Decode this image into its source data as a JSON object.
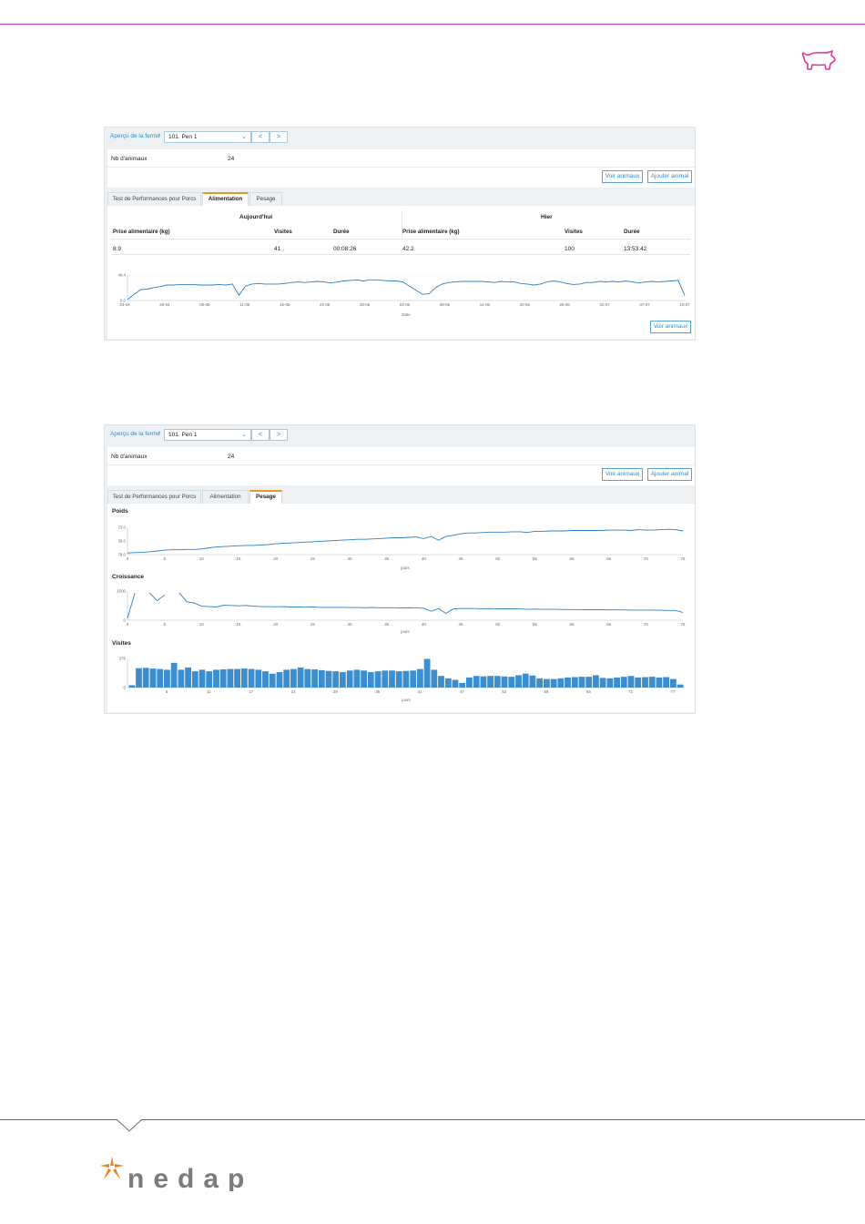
{
  "header": {
    "logo_icon": "pig-icon",
    "accent": "#c23ab8"
  },
  "panels": [
    {
      "breadcrumb": {
        "link": "Aperçu de la ferme",
        "separator": "›",
        "pen": "101. Pen 1",
        "prev": "<",
        "next": ">"
      },
      "info": {
        "label": "Nb d'animaux",
        "count": "24"
      },
      "buttons": {
        "see_animals": "Voir animaux",
        "add_animal": "Ajouter animal"
      },
      "tabs": [
        "Test de Performances pour Porcs",
        "Alimentation",
        "Pesage"
      ],
      "active_tab": "Alimentation",
      "today": {
        "title": "Aujourd'hui",
        "headers": [
          "Prise alimentaire (kg)",
          "Visites",
          "Durée"
        ],
        "values": [
          "8.9",
          "41",
          "00:08:26"
        ]
      },
      "yesterday": {
        "title": "Hier",
        "headers": [
          "Prise alimentaire (kg)",
          "Visites",
          "Durée"
        ],
        "values": [
          "42.2",
          "100",
          "13:53:42"
        ]
      },
      "bottom_button": "Voir animaux"
    },
    {
      "breadcrumb": {
        "link": "Aperçu de la ferme",
        "separator": "›",
        "pen": "101. Pen 1",
        "prev": "<",
        "next": ">"
      },
      "info": {
        "label": "Nb d'animaux",
        "count": "24"
      },
      "buttons": {
        "see_animals": "Voir animaux",
        "add_animal": "Ajouter animal"
      },
      "tabs": [
        "Test de Performances pour Porcs",
        "Alimentation",
        "Pesage"
      ],
      "active_tab": "Pesage",
      "charts": {
        "weight_title": "Poids",
        "growth_title": "Croissance",
        "visits_title": "Visites"
      }
    }
  ],
  "chart_data": [
    {
      "type": "line",
      "x_ticks": [
        "23-04",
        "29-04",
        "05-05",
        "11-05",
        "16-05",
        "22-05",
        "28-05",
        "02-06",
        "08-06",
        "14-06",
        "20-06",
        "26-06",
        "02-07",
        "07-07",
        "10-07"
      ],
      "xlabel": "Date",
      "ylim": [
        0.0,
        49.4
      ],
      "y_ticks": [
        "0.0",
        "49.4"
      ],
      "series": [
        {
          "values": [
            2,
            12,
            21,
            22,
            25,
            27,
            30,
            30,
            31,
            31,
            31,
            30,
            30,
            30,
            31,
            30,
            32,
            10,
            28,
            32,
            33,
            32,
            32,
            32,
            33,
            35,
            36,
            35,
            36,
            37,
            36,
            34,
            36,
            38,
            39,
            40,
            38,
            40,
            40,
            39,
            38,
            38,
            36,
            28,
            20,
            12,
            13,
            25,
            32,
            35,
            36,
            37,
            37,
            37,
            37,
            36,
            35,
            37,
            36,
            36,
            33,
            32,
            30,
            32,
            36,
            38,
            36,
            33,
            31,
            32,
            35,
            35,
            37,
            36,
            37,
            36,
            38,
            36,
            34,
            36,
            37,
            36,
            37,
            38,
            39,
            10
          ]
        }
      ]
    },
    {
      "type": "line",
      "x_ticks": [
        "0",
        "5",
        "10",
        "15",
        "20",
        "25",
        "30",
        "35",
        "40",
        "45",
        "50",
        "55",
        "60",
        "65",
        "70",
        "75"
      ],
      "xlabel": "jours",
      "y_ticks": [
        "78.0",
        "39.0",
        "73.0"
      ],
      "series": [
        {
          "values": [
            4,
            5,
            6,
            7,
            9,
            11,
            12,
            12,
            13,
            13,
            14,
            17,
            19,
            20,
            21,
            22,
            23,
            23,
            24,
            25,
            27,
            28,
            29,
            30,
            31,
            32,
            33,
            34,
            35,
            36,
            37,
            38,
            38,
            39,
            40,
            41,
            42,
            42,
            43,
            44,
            40,
            45,
            36,
            45,
            48,
            52,
            54,
            54,
            55,
            56,
            56,
            56,
            57,
            57,
            55,
            58,
            58,
            59,
            59,
            59,
            60,
            60,
            60,
            60,
            60,
            61,
            61,
            61,
            60,
            62,
            61,
            61,
            62,
            63,
            62,
            59
          ]
        }
      ]
    },
    {
      "type": "line",
      "x_ticks": [
        "0",
        "5",
        "10",
        "15",
        "20",
        "25",
        "30",
        "35",
        "40",
        "45",
        "50",
        "55",
        "60",
        "65",
        "70",
        "75"
      ],
      "xlabel": "jours",
      "y_ticks": [
        "0",
        "1500"
      ],
      "series": [
        {
          "values": [
            100,
            1400,
            null,
            1400,
            1000,
            1300,
            null,
            1400,
            950,
            880,
            720,
            700,
            680,
            770,
            760,
            740,
            760,
            720,
            700,
            700,
            690,
            700,
            680,
            680,
            670,
            680,
            660,
            660,
            660,
            660,
            650,
            650,
            640,
            650,
            640,
            640,
            640,
            630,
            640,
            630,
            620,
            460,
            600,
            350,
            580,
            600,
            600,
            600,
            590,
            600,
            580,
            590,
            580,
            580,
            560,
            570,
            560,
            560,
            560,
            550,
            550,
            550,
            540,
            540,
            540,
            530,
            530,
            530,
            520,
            520,
            520,
            520,
            510,
            500,
            500,
            400
          ]
        }
      ]
    },
    {
      "type": "bar",
      "x_ticks": [
        "5",
        "11",
        "17",
        "23",
        "29",
        "35",
        "41",
        "47",
        "53",
        "59",
        "65",
        "71",
        "77"
      ],
      "xlabel": "jours",
      "y_ticks": [
        "0",
        "376"
      ],
      "values": [
        30,
        250,
        255,
        245,
        240,
        230,
        320,
        230,
        260,
        210,
        230,
        210,
        230,
        235,
        240,
        240,
        245,
        240,
        230,
        210,
        180,
        200,
        230,
        240,
        260,
        240,
        235,
        225,
        215,
        210,
        200,
        220,
        230,
        220,
        200,
        210,
        220,
        220,
        210,
        215,
        220,
        240,
        370,
        230,
        150,
        120,
        100,
        60,
        130,
        150,
        145,
        150,
        150,
        145,
        140,
        160,
        180,
        155,
        120,
        110,
        110,
        120,
        130,
        135,
        140,
        140,
        160,
        125,
        120,
        130,
        140,
        150,
        130,
        135,
        140,
        130,
        135,
        110,
        40
      ]
    }
  ],
  "footer": {
    "brand_icon": "nedap-star-icon",
    "brand": "nedap",
    "star_color": "#f07f1c",
    "text_color": "#7b7b7b"
  }
}
